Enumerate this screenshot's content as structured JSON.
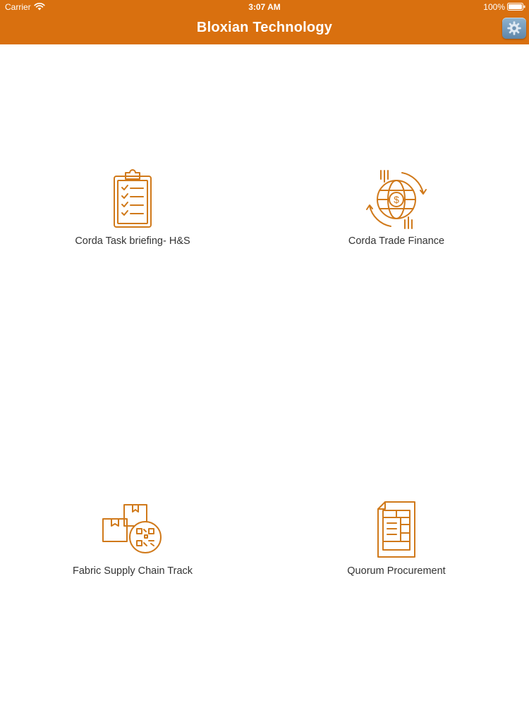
{
  "status_bar": {
    "carrier": "Carrier",
    "time": "3:07 AM",
    "battery": "100%"
  },
  "nav": {
    "title": "Bloxian Technology",
    "settings_icon": "gear-icon"
  },
  "colors": {
    "brand": "#d9700f",
    "icon_stroke": "#d0791a",
    "label_text": "#333333"
  },
  "tiles": [
    {
      "label": "Corda Task briefing- H&S",
      "icon": "clipboard-checklist-icon"
    },
    {
      "label": "Corda Trade Finance",
      "icon": "globe-dollar-exchange-icon"
    },
    {
      "label": "Fabric Supply Chain Track",
      "icon": "boxes-qr-code-icon"
    },
    {
      "label": "Quorum Procurement",
      "icon": "document-form-icon"
    }
  ]
}
